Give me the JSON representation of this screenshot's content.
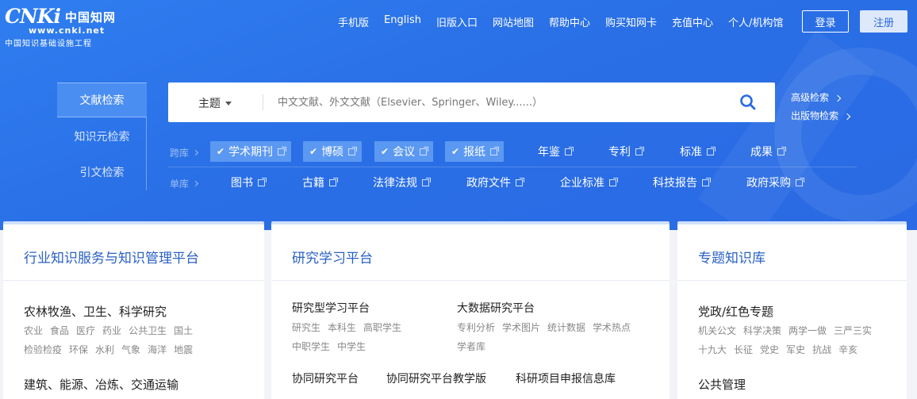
{
  "logo": {
    "main": "CNKi",
    "cn": "中国知网",
    "url": "www.cnki.net",
    "sub": "中国知识基础设施工程"
  },
  "topnav": [
    "手机版",
    "English",
    "旧版入口",
    "网站地图",
    "帮助中心",
    "购买知网卡",
    "充值中心",
    "个人/机构馆"
  ],
  "auth": {
    "login": "登录",
    "register": "注册"
  },
  "lefttabs": [
    "文献检索",
    "知识元检索",
    "引文检索"
  ],
  "search": {
    "category": "主题",
    "placeholder": "中文文献、外文文献（Elsevier、Springer、Wiley......）"
  },
  "adv_links": [
    "高级检索",
    "出版物检索"
  ],
  "rows": {
    "cross_label": "跨库",
    "single_label": "单库",
    "cross": [
      {
        "label": "学术期刊",
        "checked": true
      },
      {
        "label": "博硕",
        "checked": true
      },
      {
        "label": "会议",
        "checked": true
      },
      {
        "label": "报纸",
        "checked": true
      },
      {
        "label": "年鉴",
        "checked": false
      },
      {
        "label": "专利",
        "checked": false
      },
      {
        "label": "标准",
        "checked": false
      },
      {
        "label": "成果",
        "checked": false
      }
    ],
    "single": [
      "图书",
      "古籍",
      "法律法规",
      "政府文件",
      "企业标准",
      "科技报告",
      "政府采购"
    ]
  },
  "cards": {
    "industry": {
      "title": "行业知识服务与知识管理平台",
      "sec1": "农林牧渔、卫生、科学研究",
      "sec1_links_a": [
        "农业",
        "食品",
        "医疗",
        "药业",
        "公共卫生",
        "国土"
      ],
      "sec1_links_b": [
        "检验检疫",
        "环保",
        "水利",
        "气象",
        "海洋",
        "地震"
      ],
      "sec2": "建筑、能源、冶炼、交通运输"
    },
    "research": {
      "title": "研究学习平台",
      "sec1": "研究型学习平台",
      "sec1_links_a": [
        "研究生",
        "本科生",
        "高职学生"
      ],
      "sec1_links_b": [
        "中职学生",
        "中学生"
      ],
      "sec2": "大数据研究平台",
      "sec2_links_a": [
        "专利分析",
        "学术图片",
        "统计数据",
        "学术热点"
      ],
      "sec2_links_b": [
        "学者库"
      ],
      "bottom": [
        "协同研究平台",
        "协同研究平台教学版",
        "科研项目申报信息库"
      ]
    },
    "topic": {
      "title": "专题知识库",
      "sec1": "党政/红色专题",
      "sec1_links_a": [
        "机关公文",
        "科学决策",
        "两学一做",
        "三严三实"
      ],
      "sec1_links_b": [
        "十九大",
        "长征",
        "党史",
        "军史",
        "抗战",
        "辛亥"
      ],
      "sec2": "公共管理"
    }
  }
}
